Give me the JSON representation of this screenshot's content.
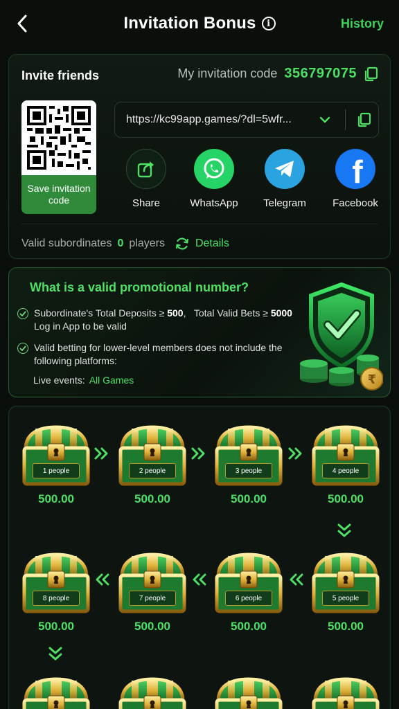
{
  "header": {
    "title": "Invitation Bonus",
    "history_label": "History"
  },
  "invite": {
    "title": "Invite friends",
    "code_label": "My invitation code",
    "code_value": "356797075",
    "save_label": "Save invitation code",
    "link": "https://kc99app.games/?dl=5wfr...",
    "share": [
      {
        "label": "Share",
        "icon": "share-icon"
      },
      {
        "label": "WhatsApp",
        "icon": "whatsapp-icon"
      },
      {
        "label": "Telegram",
        "icon": "telegram-icon"
      },
      {
        "label": "Facebook",
        "icon": "facebook-icon"
      }
    ],
    "valid_label": "Valid subordinates",
    "valid_count": "0",
    "valid_unit": "players",
    "details_label": "Details"
  },
  "promo": {
    "title": "What is a valid promotional number?",
    "line1_a": "Subordinate's Total Deposits ≥ ",
    "line1_b": "500",
    "line1_c": ",   Total Valid Bets ≥ ",
    "line1_d": "5000",
    "line1_e": "Log in App to be valid",
    "line2": "Valid betting for lower-level members does not include the following platforms:",
    "live_label": "Live events:",
    "live_value": "All Games"
  },
  "rewards": {
    "row1": [
      {
        "people": "1 people",
        "amount": "500.00"
      },
      {
        "people": "2 people",
        "amount": "500.00"
      },
      {
        "people": "3 people",
        "amount": "500.00"
      },
      {
        "people": "4 people",
        "amount": "500.00"
      }
    ],
    "row2": [
      {
        "people": "8 people",
        "amount": "500.00"
      },
      {
        "people": "7 people",
        "amount": "500.00"
      },
      {
        "people": "6 people",
        "amount": "500.00"
      },
      {
        "people": "5 people",
        "amount": "500.00"
      }
    ]
  },
  "colors": {
    "accent": "#4ee065",
    "background": "#0a0f0b",
    "whatsapp": "#25d366",
    "telegram": "#2aa3e0",
    "facebook": "#1877f2"
  }
}
